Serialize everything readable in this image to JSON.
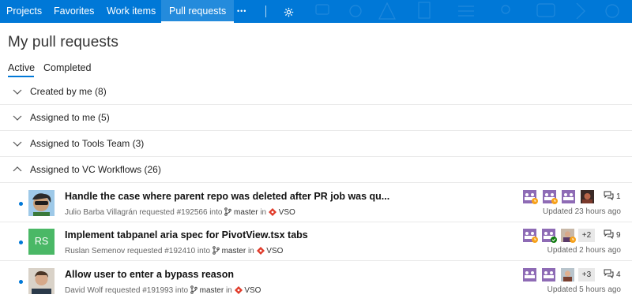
{
  "nav": {
    "items": [
      "Projects",
      "Favorites",
      "Work items",
      "Pull requests"
    ],
    "more_label": "•••",
    "settings_icon": "gear-icon",
    "active_index": 3,
    "background_color": "#0078d7"
  },
  "page": {
    "title": "My pull requests"
  },
  "tabs": {
    "active": "Active",
    "completed": "Completed"
  },
  "groups": [
    {
      "label": "Created by me (8)",
      "expanded": false
    },
    {
      "label": "Assigned to me (5)",
      "expanded": false
    },
    {
      "label": "Assigned to Tools Team (3)",
      "expanded": false
    },
    {
      "label": "Assigned to VC Workflows (26)",
      "expanded": true
    }
  ],
  "pull_requests": [
    {
      "title": "Handle the case where parent repo was deleted after PR job was qu...",
      "author": "Julio Barba Villagrán",
      "requested": "requested #192566 into",
      "branch": "master",
      "in": "in",
      "repo": "VSO",
      "avatar": "cartoon-avatar",
      "more_reviewers": "",
      "comments": "1",
      "updated": "Updated 23 hours ago"
    },
    {
      "title": "Implement tabpanel aria spec for PivotView.tsx tabs",
      "author": "Ruslan Semenov",
      "requested": "requested #192410 into",
      "branch": "master",
      "in": "in",
      "repo": "VSO",
      "avatar_initials": "RS",
      "more_reviewers": "+2",
      "comments": "9",
      "updated": "Updated 2 hours ago"
    },
    {
      "title": "Allow user to enter a bypass reason",
      "author": "David Wolf",
      "requested": "requested #191993 into",
      "branch": "master",
      "in": "in",
      "repo": "VSO",
      "avatar": "photo-avatar",
      "more_reviewers": "+3",
      "comments": "4",
      "updated": "Updated 5 hours ago"
    }
  ],
  "colors": {
    "accent": "#0078d7",
    "reviewer_purple": "#8e6bb5",
    "waiting_badge": "#f7a21b",
    "approved_badge": "#107c10",
    "repo_icon": "#e03b2a",
    "initials_avatar": "#4ab866"
  }
}
